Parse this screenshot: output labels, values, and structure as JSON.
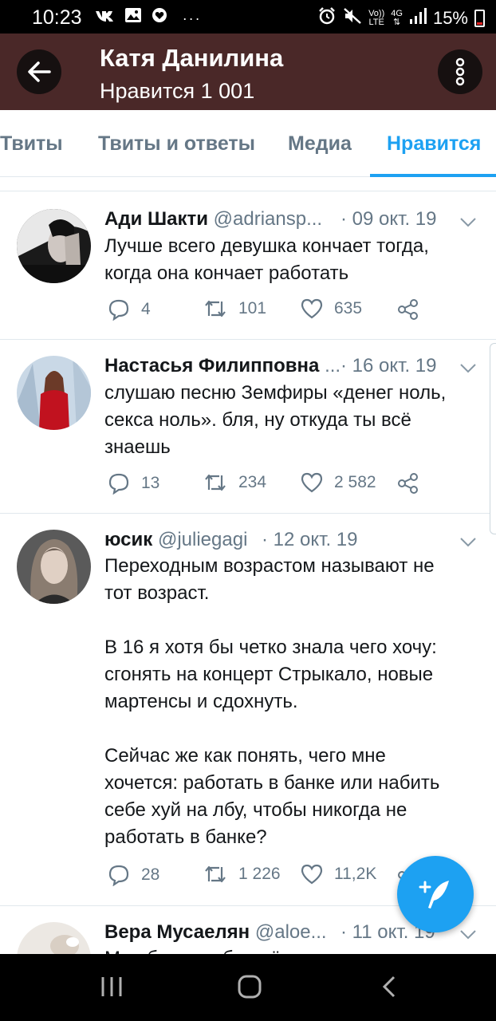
{
  "status_bar": {
    "time": "10:23",
    "notification_icons": [
      "vk-icon",
      "gallery-icon",
      "heart-icon"
    ],
    "more": "···",
    "volte_top": "Vo))",
    "volte_bottom": "LTE",
    "network": "4G",
    "battery": "15%"
  },
  "app_bar": {
    "title": "Катя Данилина",
    "subtitle": "Нравится 1 001"
  },
  "tabs": [
    {
      "label": "Твиты",
      "active": false
    },
    {
      "label": "Твиты и ответы",
      "active": false
    },
    {
      "label": "Медиа",
      "active": false
    },
    {
      "label": "Нравится",
      "active": true
    }
  ],
  "tweets": [
    {
      "name": "Ади Шакти",
      "handle": "@adriansp...",
      "date": "· 09 окт. 19",
      "text": "Лучше всего девушка кончает тогда,\nкогда она кончает работать",
      "replies": "4",
      "retweets": "101",
      "likes": "635"
    },
    {
      "name": "Настасья Филипповна",
      "handle": "...",
      "date": "· 16 окт. 19",
      "text": "слушаю песню Земфиры «денег ноль,\nсекса ноль». бля, ну откуда ты всё\nзнаешь",
      "replies": "13",
      "retweets": "234",
      "likes": "2 582"
    },
    {
      "name": "юсик",
      "handle": "@juliegagi",
      "date": "· 12 окт. 19",
      "text": "Переходным возрастом называют не\nтот возраст.\n\nВ 16 я хотя бы четко знала чего хочу:\nсгонять на концерт Стрыкало, новые\nмартенсы и сдохнуть.\n\nСейчас же как понять, чего мне\nхочется: работать в банке или набить\nсебе хуй на лбу, чтобы никогда не\nработать в банке?",
      "replies": "28",
      "retweets": "1 226",
      "likes": "11,2K"
    },
    {
      "name": "Вера Мусаелян",
      "handle": "@aloe...",
      "date": "· 11 окт. 19",
      "text": "Мне бы не тебя днём и успокоиться"
    }
  ],
  "colors": {
    "app_bar": "#4a2828",
    "accent": "#1da1f2",
    "secondary_text": "#657786"
  }
}
